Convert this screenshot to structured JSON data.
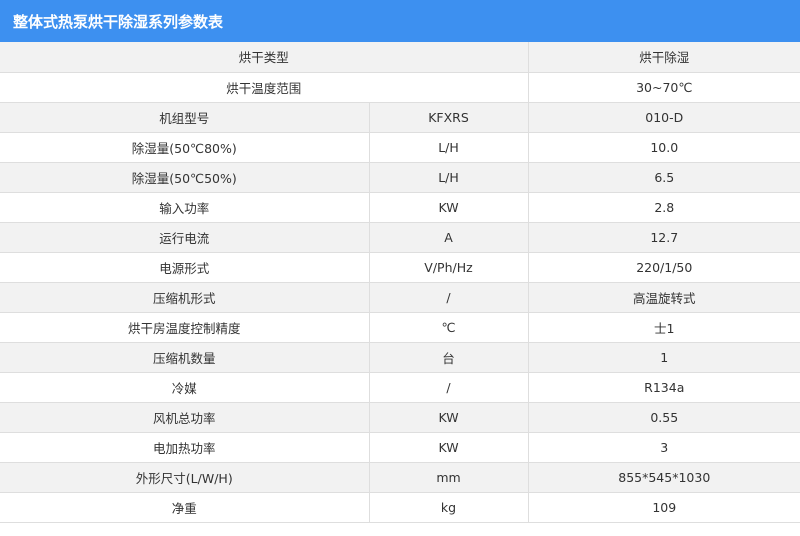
{
  "title": "整体式热泵烘干除湿系列参数表",
  "rows": [
    {
      "name": "烘干类型",
      "unit": null,
      "value": "烘干除湿"
    },
    {
      "name": "烘干温度范围",
      "unit": null,
      "value": "30~70℃"
    },
    {
      "name": "机组型号",
      "unit": "KFXRS",
      "value": "010-D"
    },
    {
      "name": "除湿量(50℃80%)",
      "unit": "L/H",
      "value": "10.0"
    },
    {
      "name": "除湿量(50℃50%)",
      "unit": "L/H",
      "value": "6.5"
    },
    {
      "name": "输入功率",
      "unit": "KW",
      "value": "2.8"
    },
    {
      "name": "运行电流",
      "unit": "A",
      "value": "12.7"
    },
    {
      "name": "电源形式",
      "unit": "V/Ph/Hz",
      "value": "220/1/50"
    },
    {
      "name": "压缩机形式",
      "unit": "/",
      "value": "高温旋转式"
    },
    {
      "name": "烘干房温度控制精度",
      "unit": "℃",
      "value": "士1"
    },
    {
      "name": "压缩机数量",
      "unit": "台",
      "value": "1"
    },
    {
      "name": "冷媒",
      "unit": "/",
      "value": "R134a"
    },
    {
      "name": "风机总功率",
      "unit": "KW",
      "value": "0.55"
    },
    {
      "name": "电加热功率",
      "unit": "KW",
      "value": "3"
    },
    {
      "name": "外形尺寸(L/W/H)",
      "unit": "mm",
      "value": "855*545*1030"
    },
    {
      "name": "净重",
      "unit": "kg",
      "value": "109"
    }
  ]
}
